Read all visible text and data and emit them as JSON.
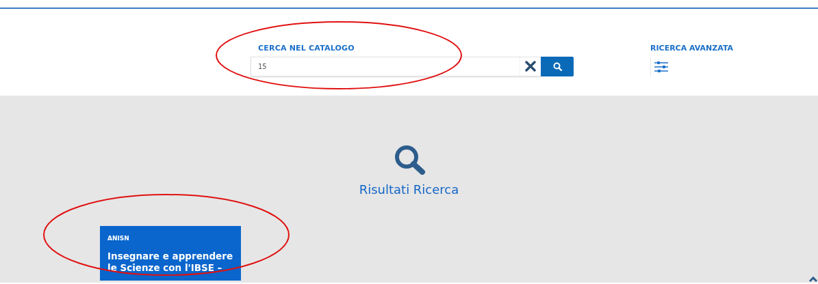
{
  "search": {
    "label": "CERCA NEL CATALOGO",
    "value": "15"
  },
  "advanced_search": {
    "label": "RICERCA AVANZATA"
  },
  "results": {
    "title": "Risultati Ricerca"
  },
  "cards": [
    {
      "source": "ANISN",
      "title": "Insegnare e apprendere le Scienze con l'IBSE –"
    }
  ]
}
